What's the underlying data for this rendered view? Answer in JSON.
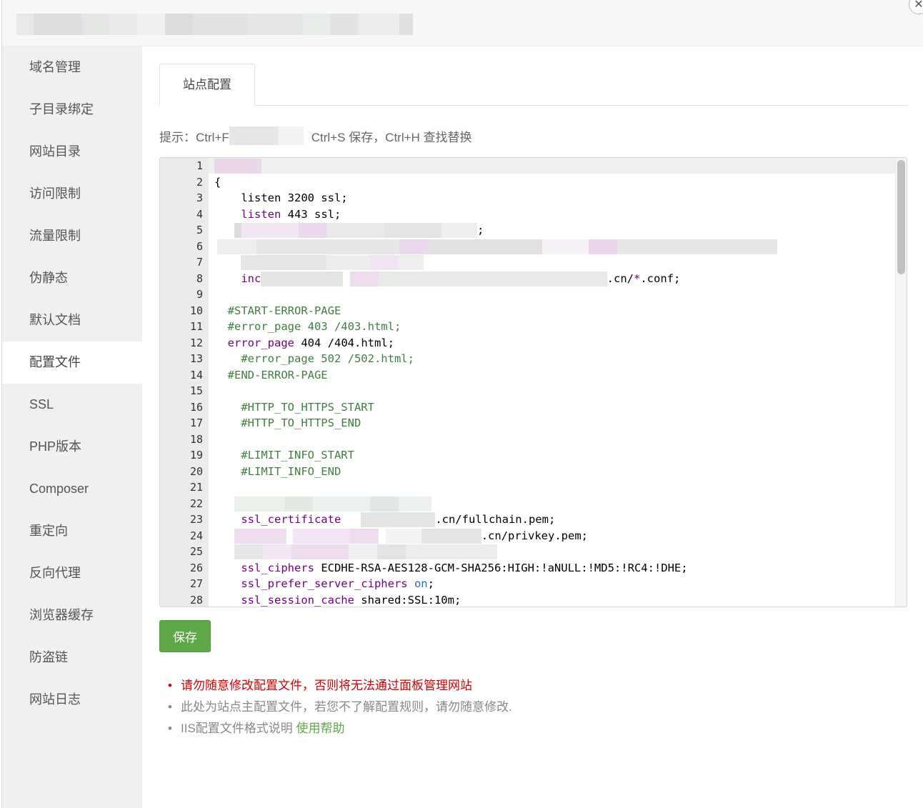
{
  "sidebar": {
    "items": [
      {
        "label": "域名管理"
      },
      {
        "label": "子目录绑定"
      },
      {
        "label": "网站目录"
      },
      {
        "label": "访问限制"
      },
      {
        "label": "流量限制"
      },
      {
        "label": "伪静态"
      },
      {
        "label": "默认文档"
      },
      {
        "label": "配置文件"
      },
      {
        "label": "SSL"
      },
      {
        "label": "PHP版本"
      },
      {
        "label": "Composer"
      },
      {
        "label": "重定向"
      },
      {
        "label": "反向代理"
      },
      {
        "label": "浏览器缓存"
      },
      {
        "label": "防盗链"
      },
      {
        "label": "网站日志"
      }
    ],
    "active_index": 7
  },
  "main": {
    "tab_label": "站点配置",
    "hint_prefix": "提示：Ctrl+F",
    "hint_suffix": "Ctrl+S 保存，Ctrl+H 查找替换",
    "save_label": "保存"
  },
  "editor": {
    "line_numbers": [
      "1",
      "2",
      "3",
      "4",
      "5",
      "6",
      "7",
      "8",
      "9",
      "10",
      "11",
      "12",
      "13",
      "14",
      "15",
      "16",
      "17",
      "18",
      "19",
      "20",
      "21",
      "22",
      "23",
      "24",
      "25",
      "26",
      "27",
      "28"
    ],
    "lines": {
      "l2": "{",
      "l3_a": "    listen 3200 ssl;",
      "l4_kw": "listen",
      "l4_rest": " 443 ssl;",
      "l5_end": ";",
      "l8_kw": "inc",
      "l8_end": ".cn/",
      "l8_star": "*",
      "l8_tail": ".conf;",
      "l10": "  #START-ERROR-PAGE",
      "l11": "  #error_page 403 /403.html;",
      "l12_kw": "error_page",
      "l12_rest": " 404 /404.html;",
      "l13": "    #error_page 502 /502.html;",
      "l14": "  #END-ERROR-PAGE",
      "l16": "    #HTTP_TO_HTTPS_START",
      "l17": "    #HTTP_TO_HTTPS_END",
      "l19": "    #LIMIT_INFO_START",
      "l20": "    #LIMIT_INFO_END",
      "l23_kw": "ssl_certificate",
      "l23_end": ".cn/fullchain.pem;",
      "l24_end": ".cn/privkey.pem;",
      "l26_kw": "ssl_ciphers",
      "l26_rest": " ECDHE-RSA-AES128-GCM-SHA256:HIGH:!aNULL:!MD5:!RC4:!DHE;",
      "l27_kw": "ssl_prefer_server_ciphers",
      "l27_atom": "on",
      "l27_end": ";",
      "l28_kw": "ssl_session_cache",
      "l28_rest": " shared:SSL:10m;"
    }
  },
  "notes": {
    "warning": "请勿随意修改配置文件，否则将无法通过面板管理网站",
    "info": "此处为站点主配置文件，若您不了解配置规则，请勿随意修改.",
    "help_prefix": "IIS配置文件格式说明 ",
    "help_link": "使用帮助"
  },
  "colors": {
    "accent": "#5fa84a",
    "warning": "#d60000",
    "comment": "#3f7f3f",
    "keyword": "#770088",
    "atom": "#2e6acc"
  }
}
